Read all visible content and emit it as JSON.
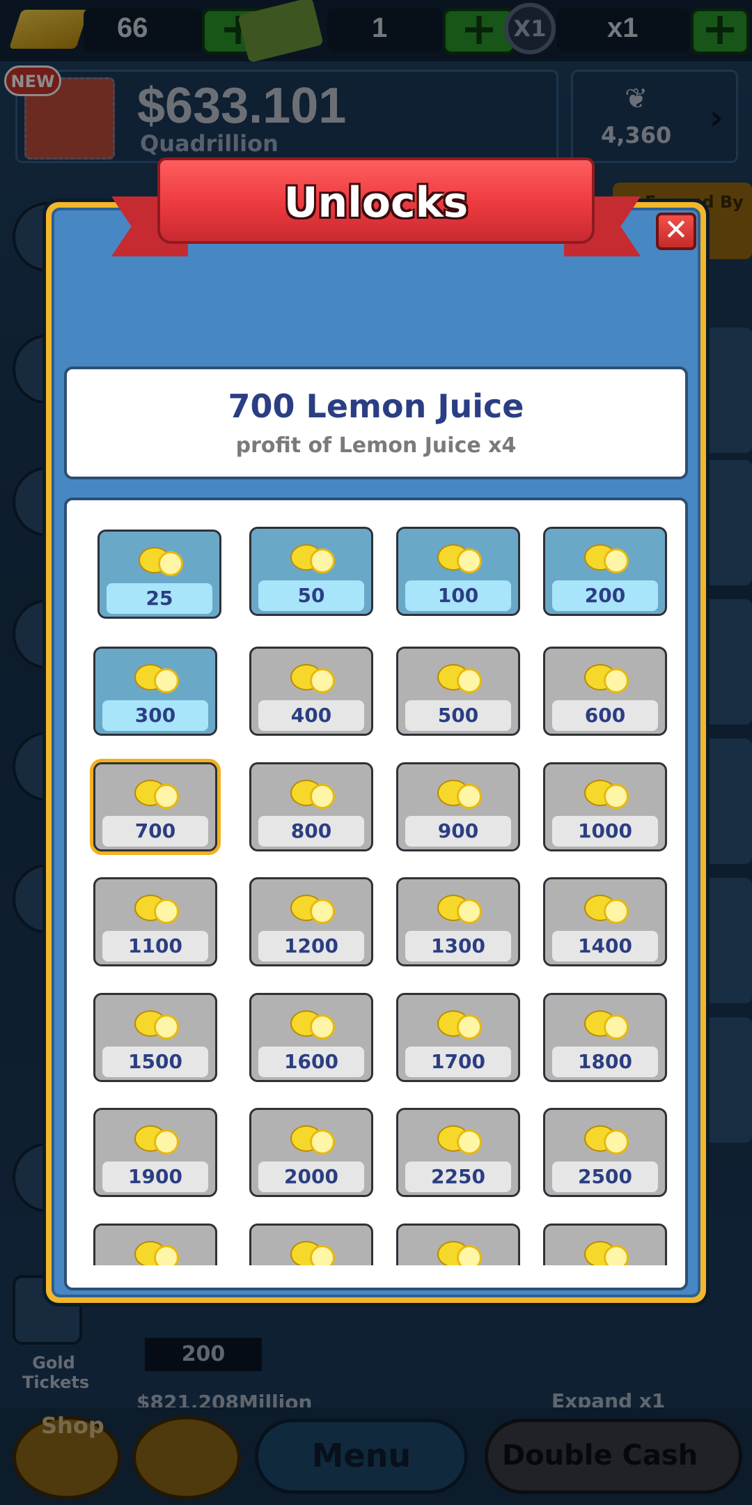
{
  "topbar": {
    "gold_count": "66",
    "cash_count": "1",
    "multiplier_icon": "X1",
    "multiplier": "x1",
    "plus": "+"
  },
  "money": {
    "new_badge": "NEW",
    "amount": "$633.101",
    "unit": "Quadrillion"
  },
  "wings": {
    "count": "4,360"
  },
  "background": {
    "expand_by_label": "Expand By",
    "counter_200": "200",
    "gold_tickets_label": "Gold Tickets",
    "progress_text": "$821.208Million",
    "expand_x1": "Expand x1"
  },
  "bottom": {
    "shop_label": "Shop",
    "menu_label": "Menu",
    "double_cash_label": "Double Cash"
  },
  "modal": {
    "title": "Unlocks",
    "close_label": "✕",
    "selected": {
      "title": "700 Lemon Juice",
      "subtitle": "profit of Lemon Juice x4"
    },
    "tiles": [
      {
        "value": "25",
        "unlocked": true
      },
      {
        "value": "50",
        "unlocked": true
      },
      {
        "value": "100",
        "unlocked": true
      },
      {
        "value": "200",
        "unlocked": true
      },
      {
        "value": "300",
        "unlocked": true
      },
      {
        "value": "400",
        "unlocked": false
      },
      {
        "value": "500",
        "unlocked": false
      },
      {
        "value": "600",
        "unlocked": false
      },
      {
        "value": "700",
        "unlocked": false,
        "selected": true
      },
      {
        "value": "800",
        "unlocked": false
      },
      {
        "value": "900",
        "unlocked": false
      },
      {
        "value": "1000",
        "unlocked": false
      },
      {
        "value": "1100",
        "unlocked": false
      },
      {
        "value": "1200",
        "unlocked": false
      },
      {
        "value": "1300",
        "unlocked": false
      },
      {
        "value": "1400",
        "unlocked": false
      },
      {
        "value": "1500",
        "unlocked": false
      },
      {
        "value": "1600",
        "unlocked": false
      },
      {
        "value": "1700",
        "unlocked": false
      },
      {
        "value": "1800",
        "unlocked": false
      },
      {
        "value": "1900",
        "unlocked": false
      },
      {
        "value": "2000",
        "unlocked": false
      },
      {
        "value": "2250",
        "unlocked": false
      },
      {
        "value": "2500",
        "unlocked": false
      },
      {
        "value": "",
        "unlocked": false
      },
      {
        "value": "",
        "unlocked": false
      },
      {
        "value": "",
        "unlocked": false
      },
      {
        "value": "",
        "unlocked": false
      }
    ]
  },
  "icon": "lemon-icon"
}
